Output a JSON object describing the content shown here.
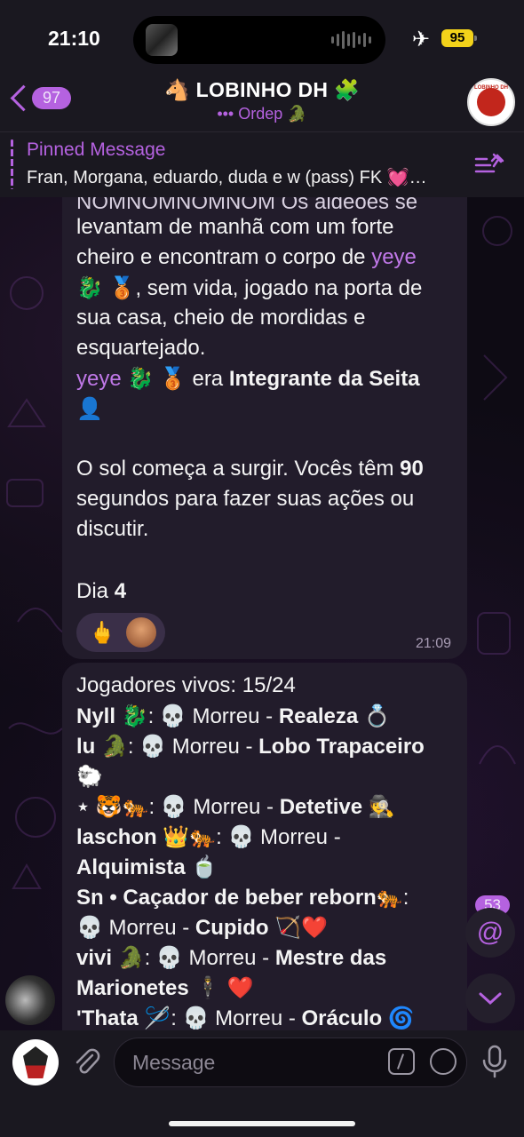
{
  "status_bar": {
    "time": "21:10",
    "battery": "95"
  },
  "header": {
    "back_count": "97",
    "title": "🐴 LOBINHO DH 🧩",
    "subtitle": "••• Ordep 🐊",
    "avatar_text": "LOBINHO DH"
  },
  "pinned": {
    "title": "Pinned Message",
    "text": "Fran, Morgana, eduardo, duda e w (pass) FK 💓…"
  },
  "message1": {
    "line0": "NOMNOMNOMNOM Os aldeões se",
    "line1": "levantam de manhã com um forte",
    "line2_a": "cheiro e encontram o corpo de ",
    "line2_b": "yeye",
    "line3_a": "🐉 🥉",
    "line3_b": ", sem vida, jogado na porta de",
    "line4": "sua casa, cheio de mordidas e",
    "line5": "esquartejado.",
    "line6_a": "yeye 🐉 🥉",
    "line6_b": " era ",
    "line6_c": "Integrante da Seita",
    "line7": "👤",
    "line8_a": "O sol começa a surgir. Vocês têm ",
    "line8_b": "90",
    "line9": "segundos para fazer suas ações ou",
    "line10": "discutir.",
    "line11_a": "Dia ",
    "line11_b": "4",
    "reaction_emoji": "🖕",
    "time": "21:09"
  },
  "message2": {
    "line0": "Jogadores vivos: 15/24",
    "l1_name": "Nyll 🐉",
    "l1_mid": ": 💀 Morreu - ",
    "l1_role": "Realeza 💍",
    "l2_name": "lu 🐊",
    "l2_mid": ": 💀 Morreu - ",
    "l2_role": "Lobo Trapaceiro",
    "l3": "🐑",
    "l4_name": "⋆ 🐯🐅",
    "l4_mid": ": 💀 Morreu - ",
    "l4_role": "Detetive 🕵",
    "l5_name": "laschon 👑🐅",
    "l5_mid": ": 💀 Morreu -",
    "l6_role": "Alquimista 🍵",
    "l7_name": "Sn • Caçador de beber reborn🐅",
    "l7_mid": ":",
    "l8_mid": "💀 Morreu - ",
    "l8_role": "Cupido 🏹❤️",
    "l9_name": "vivi 🐊",
    "l9_mid": ": 💀 Morreu - ",
    "l9_role": "Mestre das",
    "l10_role": "Marionetes 🕴 ❤️",
    "l11_name": "'Thata 🪡",
    "l11_mid": ": 💀 Morreu - ",
    "l11_role": "Oráculo 🌀"
  },
  "floating": {
    "mention_count": "53",
    "mention_symbol": "@"
  },
  "input": {
    "placeholder": "Message"
  },
  "colors": {
    "accent": "#b562e0",
    "bubble": "#221c2b",
    "bar": "#1a1820"
  }
}
